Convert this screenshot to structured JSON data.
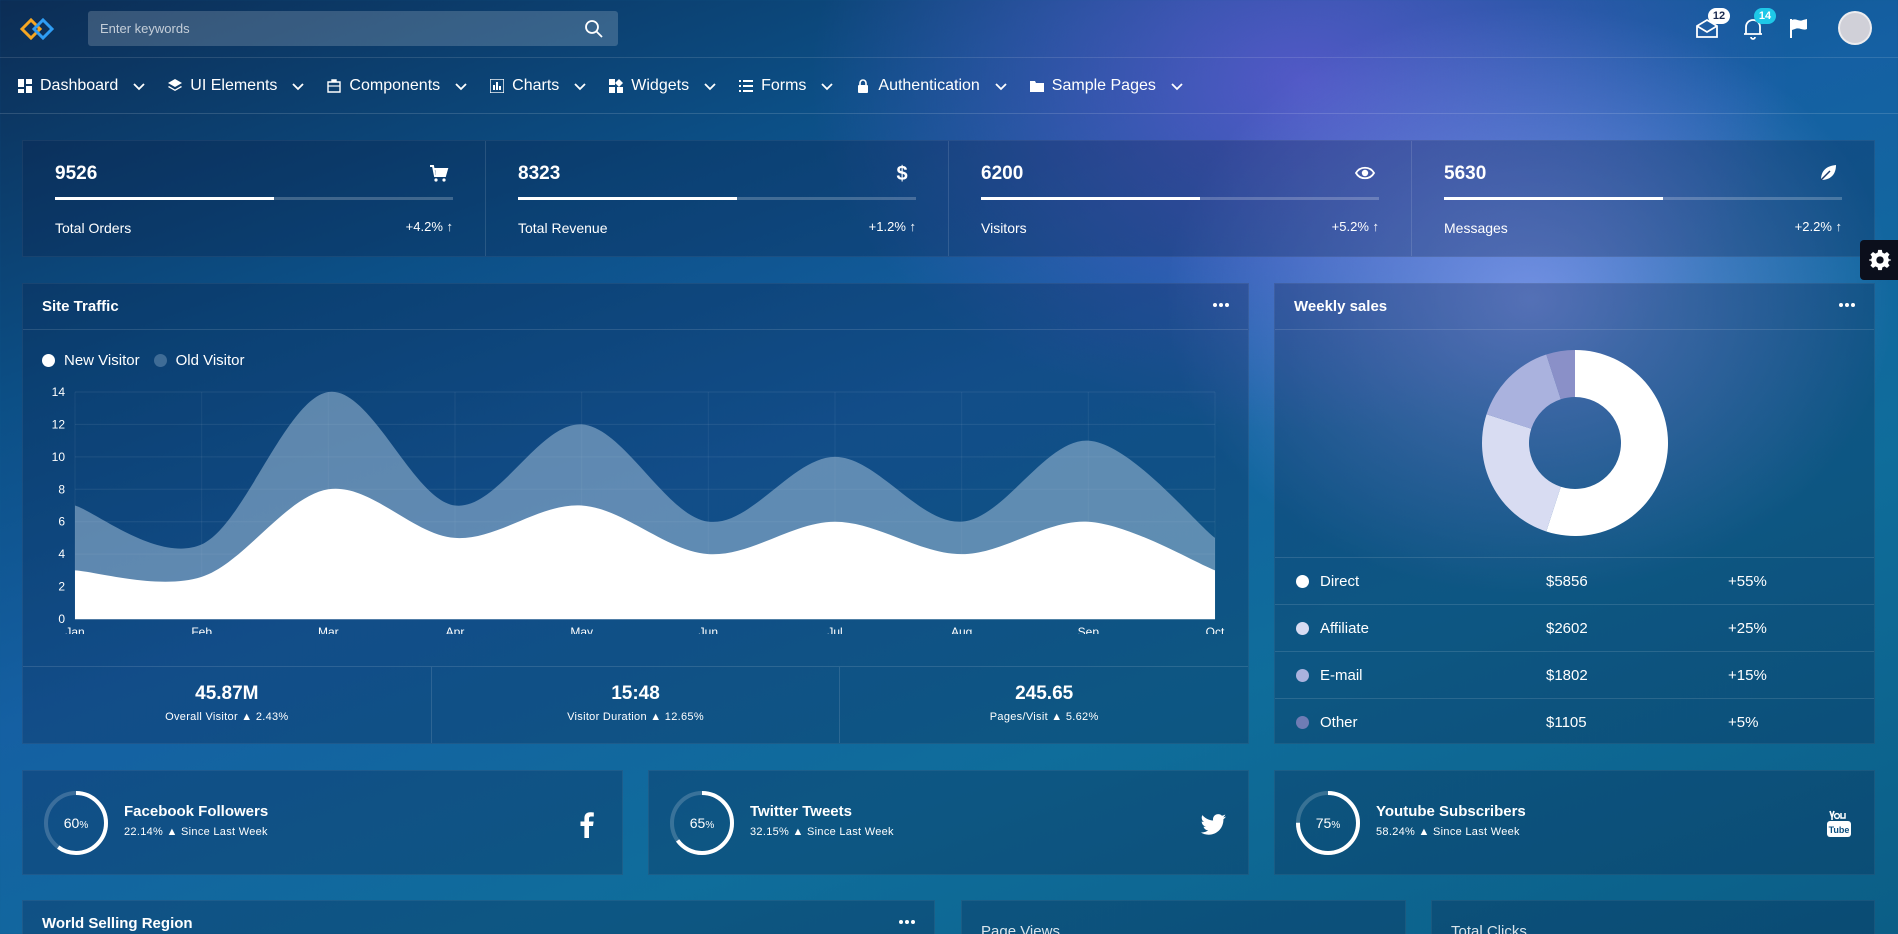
{
  "header": {
    "search_placeholder": "Enter keywords",
    "mail_badge": "12",
    "notif_badge": "14",
    "colors": {
      "mail_badge": "#ffffff",
      "notif_badge": "#1ec8e8"
    }
  },
  "nav": {
    "items": [
      {
        "label": "Dashboard",
        "icon": "dashboard-icon"
      },
      {
        "label": "UI Elements",
        "icon": "layers-icon"
      },
      {
        "label": "Components",
        "icon": "briefcase-icon"
      },
      {
        "label": "Charts",
        "icon": "chart-icon"
      },
      {
        "label": "Widgets",
        "icon": "widgets-icon"
      },
      {
        "label": "Forms",
        "icon": "list-icon"
      },
      {
        "label": "Authentication",
        "icon": "lock-icon"
      },
      {
        "label": "Sample Pages",
        "icon": "folder-icon"
      }
    ]
  },
  "stats": [
    {
      "value": "9526",
      "label": "Total Orders",
      "change": "+4.2% ↑",
      "progress": 0.55,
      "icon": "cart-icon"
    },
    {
      "value": "8323",
      "label": "Total Revenue",
      "change": "+1.2% ↑",
      "progress": 0.55,
      "icon": "dollar-icon"
    },
    {
      "value": "6200",
      "label": "Visitors",
      "change": "+5.2% ↑",
      "progress": 0.55,
      "icon": "eye-icon"
    },
    {
      "value": "5630",
      "label": "Messages",
      "change": "+2.2% ↑",
      "progress": 0.55,
      "icon": "leaf-icon"
    }
  ],
  "traffic": {
    "title": "Site Traffic",
    "summary": [
      {
        "value": "45.87M",
        "label": "Overall Visitor",
        "change": "2.43%"
      },
      {
        "value": "15:48",
        "label": "Visitor Duration",
        "change": "12.65%"
      },
      {
        "value": "245.65",
        "label": "Pages/Visit",
        "change": "5.62%"
      }
    ]
  },
  "chart_data": {
    "type": "area",
    "title": "Site Traffic",
    "categories": [
      "Jan",
      "Feb",
      "Mar",
      "Apr",
      "May",
      "Jun",
      "Jul",
      "Aug",
      "Sep",
      "Oct"
    ],
    "series": [
      {
        "name": "New Visitor",
        "values": [
          3,
          2.6,
          8,
          5,
          7,
          4,
          6,
          4,
          6,
          3
        ],
        "color": "#ffffff"
      },
      {
        "name": "Old Visitor",
        "values": [
          7,
          4.6,
          14,
          7,
          12,
          6,
          10,
          6,
          11,
          5
        ],
        "color": "rgba(160,190,215,0.55)"
      }
    ],
    "ylim": [
      0,
      14
    ],
    "yticks": [
      0,
      2,
      4,
      6,
      8,
      10,
      12,
      14
    ],
    "grid": true,
    "legend": "top-left"
  },
  "weekly": {
    "title": "Weekly sales",
    "rows": [
      {
        "name": "Direct",
        "amount": "$5856",
        "pct": "+55%",
        "share": 0.55,
        "color": "#ffffff"
      },
      {
        "name": "Affiliate",
        "amount": "$2602",
        "pct": "+25%",
        "share": 0.25,
        "color": "#d8dcf2"
      },
      {
        "name": "E-mail",
        "amount": "$1802",
        "pct": "+15%",
        "share": 0.15,
        "color": "#aab2de"
      },
      {
        "name": "Other",
        "amount": "$1105",
        "pct": "+5%",
        "share": 0.05,
        "color": "#8a90c8"
      }
    ]
  },
  "social": [
    {
      "title": "Facebook Followers",
      "sub": "22.14%",
      "since": "Since Last Week",
      "pct": "60",
      "value": 0.6,
      "icon": "facebook-icon"
    },
    {
      "title": "Twitter Tweets",
      "sub": "32.15%",
      "since": "Since Last Week",
      "pct": "65",
      "value": 0.65,
      "icon": "twitter-icon"
    },
    {
      "title": "Youtube Subscribers",
      "sub": "58.24%",
      "since": "Since Last Week",
      "pct": "75",
      "value": 0.75,
      "icon": "youtube-icon"
    }
  ],
  "bottom": {
    "region_title": "World Selling Region",
    "pageviews_title": "Page Views",
    "clicks_title": "Total Clicks"
  }
}
